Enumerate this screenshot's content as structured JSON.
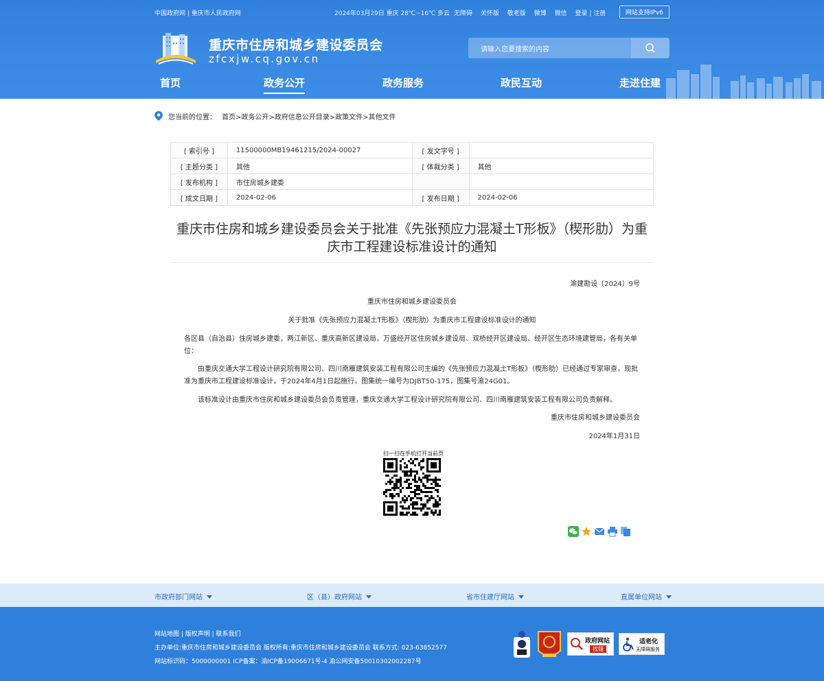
{
  "topbar": {
    "gov_links": "中国政府网 | 重庆市人民政府网",
    "date_weather": "2024年03月29日  重庆  28℃~16℃ 多云",
    "links": [
      "无障碍",
      "关怀版",
      "敬老版",
      "微博",
      "微信",
      "登录 | 注册"
    ],
    "ipv6": "网站支持IPv6"
  },
  "site": {
    "title": "重庆市住房和城乡建设委员会",
    "domain": "zfcxjw.cq.gov.cn"
  },
  "search": {
    "placeholder": "请输入您要搜索的内容",
    "icon": "search-icon"
  },
  "nav": [
    "首页",
    "政务公开",
    "政务服务",
    "政民互动",
    "走进住建"
  ],
  "breadcrumb": {
    "label": "您当前的位置：",
    "path": "首页>政务公开>政府信息公开目录>政策文件>其他文件"
  },
  "info": {
    "index_no_label": "[ 索引号 ]",
    "index_no": "11500000MB19461215/2024-00027",
    "doc_no_label": "[ 发文字号 ]",
    "doc_no": "",
    "topic_label": "[ 主题分类 ]",
    "topic": "其他",
    "genre_label": "[ 体裁分类 ]",
    "genre": "其他",
    "publisher_label": "[ 发布机构 ]",
    "publisher": "市住房城乡建委",
    "created_label": "[ 成文日期 ]",
    "created": "2024-02-06",
    "published_label": "[ 发布日期 ]",
    "published": "2024-02-06"
  },
  "article": {
    "title": "重庆市住房和城乡建设委员会关于批准《先张预应力混凝土T形板》（楔形肋）为重庆市工程建设标准设计的通知",
    "doc_number": "渝建勘设〔2024〕9号",
    "org": "重庆市住房和城乡建设委员会",
    "subtitle": "关于批准《先张预应力混凝土T形板》（楔形肋）为重庆市工程建设标准设计的通知",
    "recipients": "各区县（自治县）住房城乡建委，两江新区、重庆高新区建设局，万盛经开区住房城乡建设局、双桥经开区建设局、经开区生态环境建管局，各有关单位：",
    "para1": "由重庆交通大学工程设计研究院有限公司、四川南雁建筑安装工程有限公司主编的《先张预应力混凝土T形板》（楔形肋）已经通过专家审查，现批准为重庆市工程建设标准设计，于2024年4月1日起施行，图集统一编号为DJBT50-175，图集号渝24G01。",
    "para2": "该标准设计由重庆市住房和城乡建设委员会负责管理，重庆交通大学工程设计研究院有限公司、四川南雁建筑安装工程有限公司负责解释。",
    "signature": "重庆市住房和城乡建设委员会",
    "date": "2024年1月31日"
  },
  "qr": {
    "label": "扫一扫在手机打开当前页"
  },
  "share": [
    "wechat-icon",
    "favorite-icon",
    "email-icon",
    "print-icon",
    "copy-icon"
  ],
  "footer_links": [
    "市政府部门网站",
    "区（县）政府网站",
    "省市住建厅网站",
    "直属单位网站"
  ],
  "footer": {
    "line1": "网站地图 | 版权声明 | 联系我们",
    "line2": "主办单位:重庆市住房和城乡建设委员会   版权所有:重庆市住房和城乡建设委员会   联系方式: 023-63852577",
    "line3": "网站标识码：5000000001   ICP备案：渝ICP备19006671号-4   渝公网安备50010302002287号",
    "badge_find_1": "政府网站",
    "badge_find_2": "找错",
    "badge_elder_1": "适老化",
    "badge_elder_2": "无障碍服务"
  },
  "colors": {
    "primary": "#2f7fdc",
    "footlinks_bg": "#dcebf8",
    "link": "#2b6fbf"
  }
}
